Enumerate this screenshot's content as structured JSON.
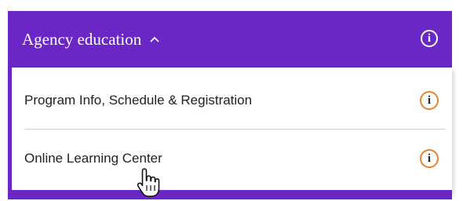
{
  "header": {
    "title": "Agency education",
    "info_glyph": "i",
    "chevron_icon": "chevron-up-icon",
    "background_color": "#6b26c6"
  },
  "menu": {
    "items": [
      {
        "label": "Program Info, Schedule & Registration",
        "info_glyph": "i",
        "icon": "info-icon"
      },
      {
        "label": "Online Learning Center",
        "info_glyph": "i",
        "icon": "info-icon"
      }
    ],
    "accent_color": "#e8822c"
  },
  "cursor": {
    "icon": "hand-pointer-icon"
  }
}
